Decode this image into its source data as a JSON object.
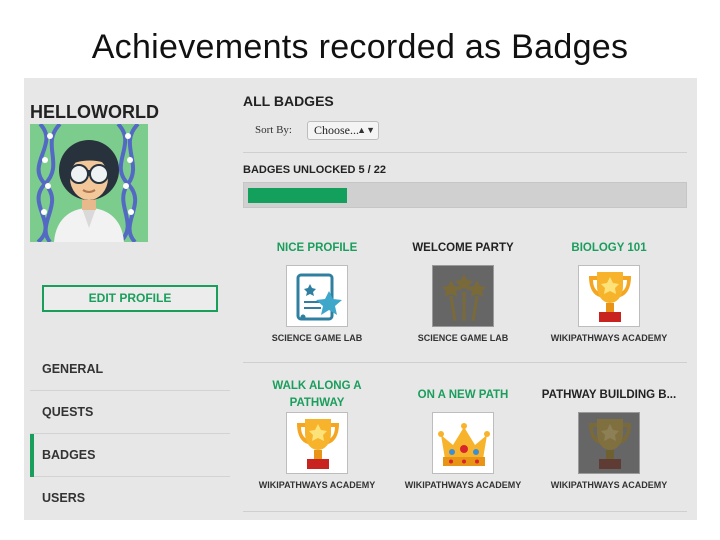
{
  "slide_title": "Achievements recorded as Badges",
  "profile": {
    "username": "HELLOWORLD",
    "edit_label": "EDIT PROFILE"
  },
  "nav": {
    "items": [
      {
        "label": "GENERAL",
        "active": false
      },
      {
        "label": "QUESTS",
        "active": false
      },
      {
        "label": "BADGES",
        "active": true
      },
      {
        "label": "USERS",
        "active": false
      }
    ]
  },
  "main": {
    "heading": "ALL BADGES",
    "sort_label": "Sort By:",
    "sort_value": "Choose...",
    "unlocked_label": "BADGES UNLOCKED 5 / 22",
    "progress_fraction": 0.227
  },
  "badges": [
    {
      "title": "NICE PROFILE",
      "issuer": "SCIENCE GAME LAB",
      "icon": "certificate-icon",
      "unlocked": true
    },
    {
      "title": "WELCOME PARTY",
      "issuer": "SCIENCE GAME LAB",
      "icon": "party-stars-icon",
      "unlocked": false
    },
    {
      "title": "BIOLOGY 101",
      "issuer": "WIKIPATHWAYS ACADEMY",
      "icon": "trophy-icon",
      "unlocked": true
    },
    {
      "title": "WALK ALONG A PATHWAY",
      "issuer": "WIKIPATHWAYS ACADEMY",
      "icon": "trophy-icon",
      "unlocked": true
    },
    {
      "title": "ON A NEW PATH",
      "issuer": "WIKIPATHWAYS ACADEMY",
      "icon": "crown-icon",
      "unlocked": true
    },
    {
      "title": "PATHWAY BUILDING B...",
      "issuer": "WIKIPATHWAYS ACADEMY",
      "icon": "trophy-icon",
      "unlocked": false
    }
  ],
  "colors": {
    "accent": "#1a9e5c",
    "panel": "#e7e7e7",
    "locked": "#666666"
  }
}
